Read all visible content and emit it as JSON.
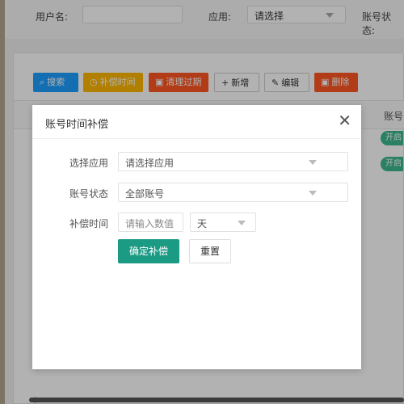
{
  "filters": {
    "username_label": "用户名:",
    "app_label": "应用:",
    "app_placeholder": "请选择",
    "status_label": "账号状态:"
  },
  "toolbar": {
    "search": "搜索",
    "compensate": "补偿时间",
    "clear_expired": "清理过期",
    "add": "新增",
    "edit": "编辑",
    "delete": "删除"
  },
  "table": {
    "status_header": "账号",
    "rows": [
      {
        "status": "开启"
      },
      {
        "status": "开启"
      }
    ]
  },
  "modal": {
    "title": "账号时间补偿",
    "close_symbol": "✕",
    "app_label": "选择应用",
    "app_placeholder": "请选择应用",
    "status_label": "账号状态",
    "status_value": "全部账号",
    "time_label": "补偿时间",
    "time_placeholder": "请输入数值",
    "unit_value": "天",
    "confirm": "确定补偿",
    "reset": "重置"
  },
  "colors": {
    "search_btn": "#1e9fff",
    "compensate_btn": "#ffb800",
    "danger_btn": "#ff5722",
    "primary_btn": "#1b9a84",
    "status_pill": "#3cb88f"
  },
  "icons": [
    "search-icon",
    "clock-icon",
    "trash-icon",
    "plus-icon",
    "pencil-icon",
    "trash-icon",
    "close-icon",
    "chevron-down-icon"
  ]
}
